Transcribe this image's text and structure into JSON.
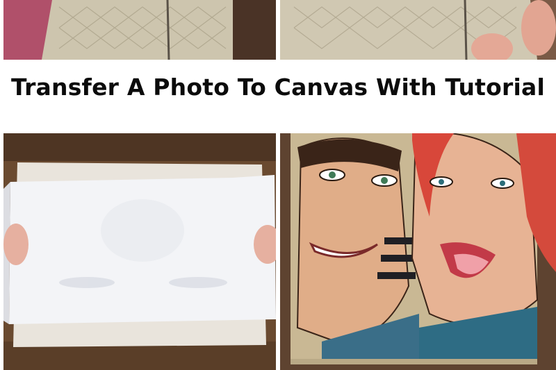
{
  "title": "Transfer A Photo To Canvas With Tutorial",
  "photos": [
    {
      "name": "top-left-vest-photo"
    },
    {
      "name": "top-right-vest-photo"
    },
    {
      "name": "bottom-left-paper-transfer-photo"
    },
    {
      "name": "bottom-right-canvas-portrait-photo"
    }
  ],
  "colors": {
    "background": "#ffffff",
    "title_text": "#0b0b0b",
    "vest": "#cbc3ac",
    "wood": "#6b4a2e",
    "canvas_skin": "#e2b08a",
    "hair_red": "#d84a3a"
  }
}
